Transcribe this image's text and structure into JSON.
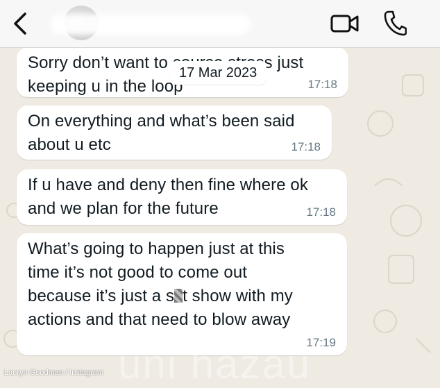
{
  "header": {
    "back_icon": "chevron-left-icon",
    "video_icon": "video-camera-icon",
    "call_icon": "phone-icon"
  },
  "date_separator": "17 Mar 2023",
  "messages": [
    {
      "line1": "Sorry don’t want to course stress just",
      "line2": "keeping u in the loop",
      "time": "17:18"
    },
    {
      "line1": "On everything and what’s been said",
      "line2": "about u etc",
      "time": "17:18"
    },
    {
      "line1": "If u have and deny then fine where ok",
      "line2": "and we plan for the future",
      "time": "17:18"
    },
    {
      "line1": "What’s going to happen just at this",
      "line2": "time it’s not good to come out",
      "line3_pre": "because it’s just a s",
      "line3_post": "t show with my",
      "line4": "actions and that need to blow away",
      "time": "17:19"
    }
  ],
  "credit": "Lauryn Goodman / Instagram",
  "watermark": "uni hazau",
  "colors": {
    "chat_background": "#efeae2",
    "bubble": "#ffffff",
    "time_text": "#667781",
    "topbar": "#f7f7f7"
  }
}
